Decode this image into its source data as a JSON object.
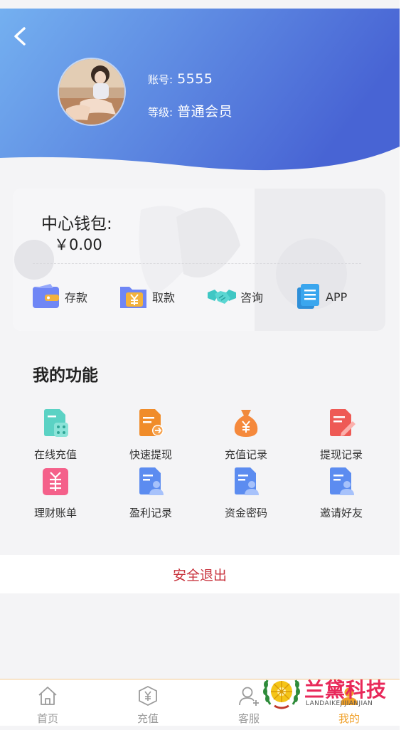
{
  "header": {
    "account_label": "账号:",
    "account_value": "5555",
    "level_label": "等级:",
    "level_value": "普通会员",
    "gradient_start": "#6fa8ee",
    "gradient_end": "#4a67d6"
  },
  "wallet": {
    "title": "中心钱包:",
    "amount": "￥0.00",
    "actions": [
      {
        "label": "存款",
        "icon": "wallet-icon"
      },
      {
        "label": "取款",
        "icon": "yuan-folder-icon"
      },
      {
        "label": "咨询",
        "icon": "handshake-icon"
      },
      {
        "label": "APP",
        "icon": "document-icon"
      }
    ]
  },
  "functions": {
    "title": "我的功能",
    "items": [
      {
        "label": "在线充值",
        "icon": "online-recharge-icon"
      },
      {
        "label": "快速提现",
        "icon": "quick-withdraw-icon"
      },
      {
        "label": "充值记录",
        "icon": "money-bag-icon"
      },
      {
        "label": "提现记录",
        "icon": "edit-record-icon"
      },
      {
        "label": "理财账单",
        "icon": "finance-bill-icon"
      },
      {
        "label": "盈利记录",
        "icon": "profit-record-icon"
      },
      {
        "label": "资金密码",
        "icon": "fund-password-icon"
      },
      {
        "label": "邀请好友",
        "icon": "invite-friend-icon"
      }
    ]
  },
  "logout_label": "安全退出",
  "tabbar": {
    "items": [
      {
        "label": "首页",
        "icon": "home-icon"
      },
      {
        "label": "充值",
        "icon": "recharge-icon"
      },
      {
        "label": "客服",
        "icon": "customer-service-icon"
      },
      {
        "label": "我的",
        "icon": "profile-icon"
      }
    ],
    "active_color": "#f0a028"
  },
  "watermark": {
    "title": "兰黛科技",
    "subtitle": "LANDAIKEJIJIANJIAN"
  }
}
